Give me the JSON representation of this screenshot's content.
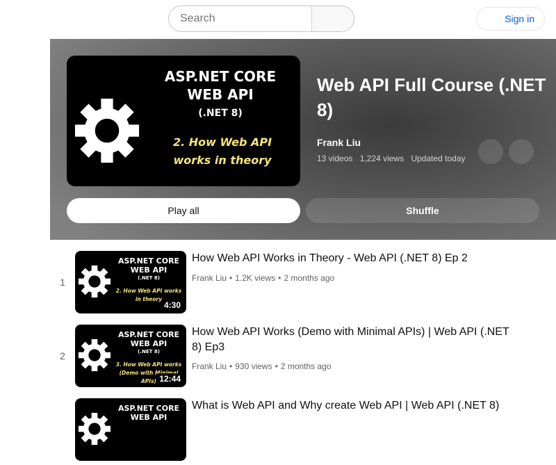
{
  "header": {
    "search_placeholder": "Search",
    "signin_label": "Sign in"
  },
  "playlist": {
    "title": "Web API Full Course (.NET 8)",
    "owner": "Frank Liu",
    "video_count": "13 videos",
    "views": "1,224 views",
    "updated": "Updated today",
    "play_all_label": "Play all",
    "shuffle_label": "Shuffle",
    "thumbnail": {
      "line1": "ASP.NET CORE",
      "line2": "WEB API",
      "line3": "(.NET 8)",
      "subtitle": "2. How Web API works in theory"
    }
  },
  "videos": [
    {
      "index": "1",
      "title": "How Web API Works in Theory - Web API (.NET 8) Ep 2",
      "channel": "Frank Liu",
      "views": "1.2K views",
      "age": "2 months ago",
      "duration": "4:30",
      "thumb": {
        "line1": "ASP.NET CORE",
        "line2": "WEB API",
        "line3": "(.NET 8)",
        "subtitle": "2. How Web API works in theory"
      }
    },
    {
      "index": "2",
      "title": "How Web API Works (Demo with Minimal APIs) | Web API (.NET 8) Ep3",
      "channel": "Frank Liu",
      "views": "930 views",
      "age": "2 months ago",
      "duration": "12:44",
      "thumb": {
        "line1": "ASP.NET CORE",
        "line2": "WEB API",
        "line3": "(.NET 8)",
        "subtitle": "3. How Web API works (Demo with Minimal APIs)"
      }
    },
    {
      "index": "3",
      "title": "What is Web API and Why create Web API | Web API (.NET 8)",
      "thumb": {
        "line1": "ASP.NET CORE",
        "line2": "WEB API"
      }
    }
  ],
  "colors": {
    "link_blue": "#065fd4",
    "subtitle_yellow": "#f7e27a",
    "hero_gray": "#808080"
  }
}
